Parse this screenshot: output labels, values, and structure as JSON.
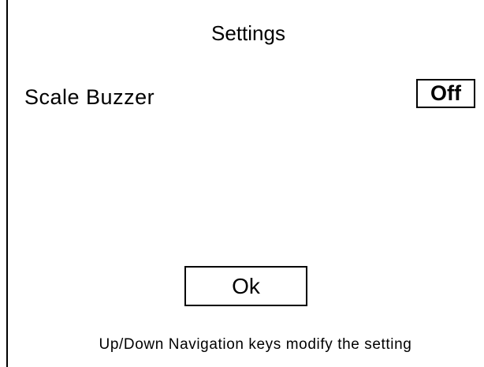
{
  "dialog": {
    "title": "Settings",
    "setting": {
      "label": "Scale Buzzer",
      "value": "Off"
    },
    "ok_label": "Ok",
    "hint": "Up/Down Navigation keys modify the setting"
  }
}
